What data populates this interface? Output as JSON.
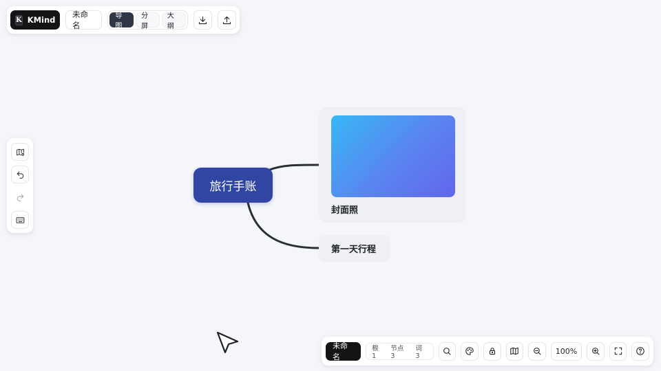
{
  "brand": {
    "logo_letter": "K",
    "name": "KMind"
  },
  "document": {
    "title": "未命名"
  },
  "view_modes": [
    {
      "label": "导图",
      "active": true
    },
    {
      "label": "分屏",
      "active": false
    },
    {
      "label": "大纲",
      "active": false
    }
  ],
  "top_actions": [
    {
      "icon": "download-icon"
    },
    {
      "icon": "upload-icon"
    }
  ],
  "left_tools": [
    {
      "icon": "map-settings-icon",
      "enabled": true
    },
    {
      "icon": "undo-icon",
      "enabled": true
    },
    {
      "icon": "redo-icon",
      "enabled": false
    },
    {
      "icon": "keyboard-icon",
      "enabled": true
    }
  ],
  "mindmap": {
    "root": {
      "label": "旅行手账",
      "color": "#3145a3"
    },
    "children": [
      {
        "label": "封面照",
        "has_image": true,
        "image_gradient": [
          "#37b8f6",
          "#6266ec"
        ]
      },
      {
        "label": "第一天行程",
        "has_image": false
      }
    ],
    "edge_color": "#2b2e36"
  },
  "status_bar": {
    "doc_name": "未命名",
    "stats": {
      "root": "根 1",
      "nodes": "节点 3",
      "words": "词 3"
    },
    "zoom": "100%",
    "buttons": [
      "search-icon",
      "theme-icon",
      "lock-icon",
      "minimap-icon",
      "zoom-out-icon",
      "zoom-in-icon",
      "fullscreen-icon",
      "help-icon"
    ]
  }
}
